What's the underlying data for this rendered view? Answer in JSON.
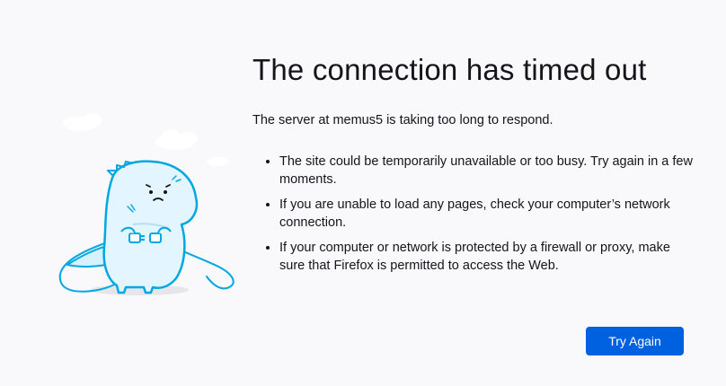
{
  "error_page": {
    "title": "The connection has timed out",
    "summary": "The server at memus5 is taking too long to respond.",
    "reasons": [
      "The site could be temporarily unavailable or too busy. Try again in a few moments.",
      "If you are unable to load any pages, check your computer’s network connection.",
      "If your computer or network is protected by a firewall or proxy, make sure that Firefox is permitted to access the Web."
    ],
    "try_again_label": "Try Again"
  },
  "illustration": {
    "icon": "dino-unplugged-cable-icon"
  },
  "colors": {
    "background": "#f9f9fb",
    "text": "#15141a",
    "button": "#0061e0",
    "illustration_fill": "#d6f1ff",
    "illustration_stroke": "#00a7e0"
  }
}
